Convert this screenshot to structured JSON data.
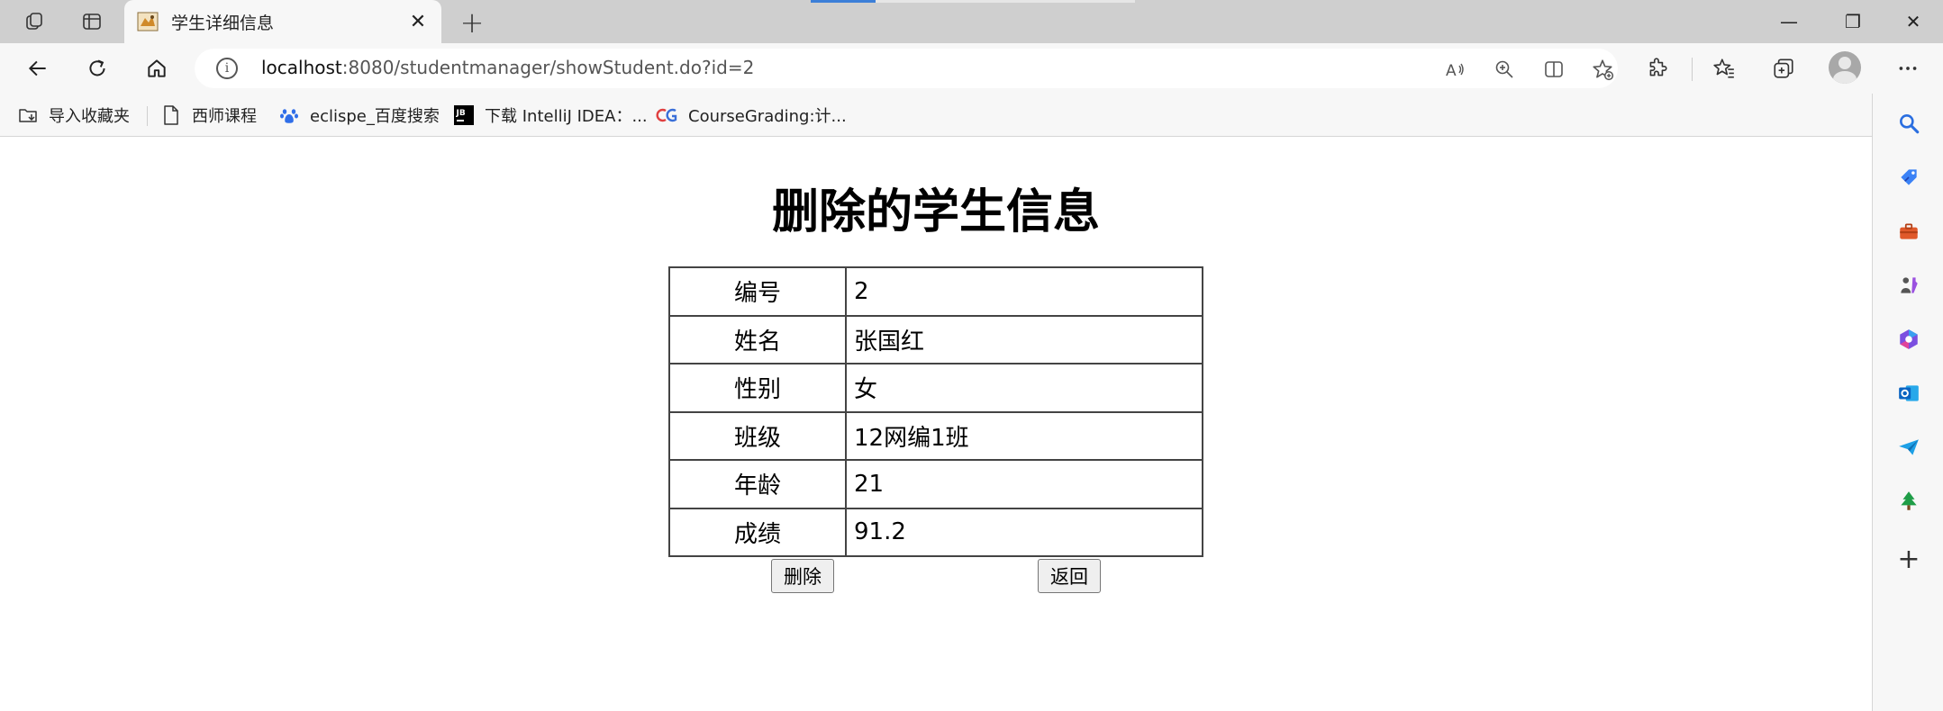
{
  "tab": {
    "title": "学生详细信息",
    "close": "✕"
  },
  "window": {
    "minimize": "—",
    "restore": "❐",
    "close": "✕"
  },
  "address": {
    "host": "localhost",
    "rest": ":8080/studentmanager/showStudent.do?id=2"
  },
  "bookmarks": [
    {
      "label": "导入收藏夹"
    },
    {
      "label": "西师课程"
    },
    {
      "label": "eclispe_百度搜索"
    },
    {
      "label": "下载 IntelliJ IDEA：..."
    },
    {
      "label": "CourseGrading:计..."
    }
  ],
  "page": {
    "title": "删除的学生信息",
    "rows": [
      {
        "label": "编号",
        "value": "2"
      },
      {
        "label": "姓名",
        "value": "张国红"
      },
      {
        "label": "性别",
        "value": "女"
      },
      {
        "label": "班级",
        "value": "12网编1班"
      },
      {
        "label": "年龄",
        "value": "21"
      },
      {
        "label": "成绩",
        "value": "91.2"
      }
    ],
    "delete_button": "删除",
    "back_button": "返回"
  },
  "colors": {
    "accent": "#3c7fd8",
    "chrome_bg": "#f7f7f7",
    "tabstrip_bg": "#cfcfcf"
  },
  "icons": [
    "workspaces-icon",
    "tab-actions-icon",
    "back-icon",
    "refresh-icon",
    "home-icon",
    "info-icon",
    "read-aloud-icon",
    "zoom-icon",
    "split-screen-icon",
    "add-favorite-icon",
    "extensions-icon",
    "favorites-icon",
    "collections-icon",
    "profile-icon",
    "more-icon",
    "search-icon",
    "tag-icon",
    "toolbox-icon",
    "games-icon",
    "office-icon",
    "outlook-icon",
    "send-icon",
    "tree-icon",
    "add-icon"
  ]
}
